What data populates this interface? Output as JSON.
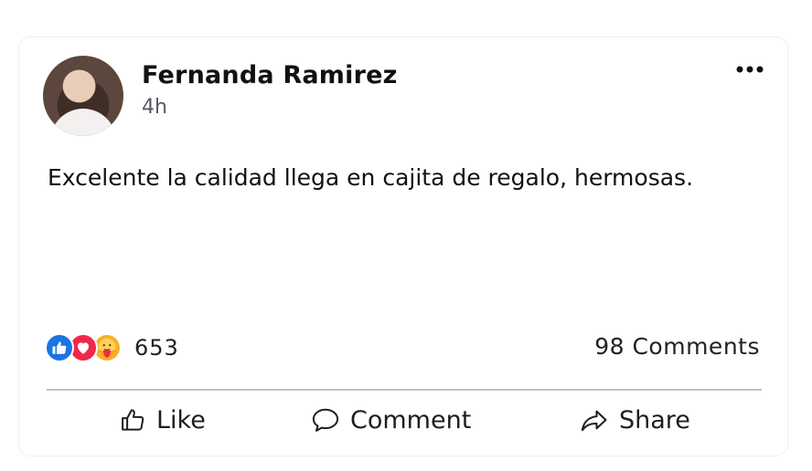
{
  "post": {
    "author": "Fernanda Ramirez",
    "time": "4h",
    "text": "Excelente la calidad llega en cajita de regalo, hermosas."
  },
  "reactions": {
    "types": [
      "like",
      "love",
      "care"
    ],
    "count": "653"
  },
  "comments_count": "98 Comments",
  "actions": {
    "like": "Like",
    "comment": "Comment",
    "share": "Share"
  },
  "colors": {
    "like": "#1b74e4",
    "love": "#f0284a",
    "care": "#f7b125",
    "divider": "#b9c2cc"
  }
}
